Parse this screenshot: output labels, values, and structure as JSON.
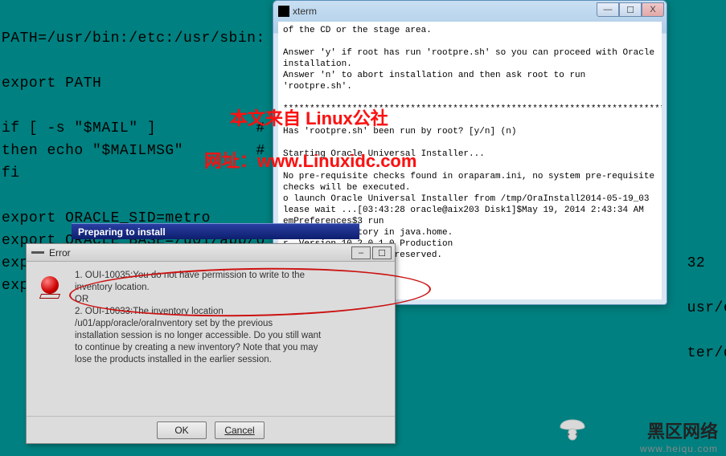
{
  "bg_terminal": "\nPATH=/usr/bin:/etc:/usr/sbin:\n\nexport PATH\n\nif [ -s \"$MAIL\" ]           #\nthen echo \"$MAILMSG\"        #\nfi\n\nexport ORACLE_SID=metro\nexport ORACLE_BASE=/u01/app/o\nexport ORACLE_HOME=$ORACLE_BA\nexport ORACLE_CRS_HOME=/u01/",
  "bg_line_right_1": "32",
  "bg_line_right_2": "usr/es",
  "bg_line_right_3": "ter/d",
  "xterm": {
    "title": "xterm",
    "body": "of the CD or the stage area.\n\nAnswer 'y' if root has run 'rootpre.sh' so you can proceed with Oracle installation.\nAnswer 'n' to abort installation and then ask root to run 'rootpre.sh'.\n\n************************************************************************\n\nHas 'rootpre.sh' been run by root? [y/n] (n)\n\nStarting Oracle Universal Installer...\n\nNo pre-requisite checks found in oraparam.ini, no system pre-requisite checks will be executed.\no launch Oracle Universal Installer from /tmp/OraInstall2014-05-19_03\nlease wait ...[03:43:28 oracle@aix203 Disk1]$May 19, 2014 2:43:34 AM\nemPreferences$3 run\nferences directory in java.home.\nr, Version 10.2.0.1.0 Production\n. Oracle. All rights reserved."
  },
  "prepare_bar": {
    "label": "Preparing to install"
  },
  "error_dialog": {
    "title": "Error",
    "body": "1. OUI-10035:You do not have permission to write to the\ninventory location.\nOR\n2. OUI-10033:The inventory location\n/u01/app/oracle/oraInventory set by the previous\ninstallation session is no longer accessible. Do you still want\nto continue by creating a new inventory? Note that you may\nlose the products installed in the earlier session.",
    "ok": "OK",
    "cancel": "Cancel"
  },
  "wm_red_line1": "本文来自 Linux公社",
  "wm_red_line2": "网址：www.Linuxidc.com",
  "wm_black_main": "黑区网络",
  "wm_black_sub": "www.heiqu.com"
}
